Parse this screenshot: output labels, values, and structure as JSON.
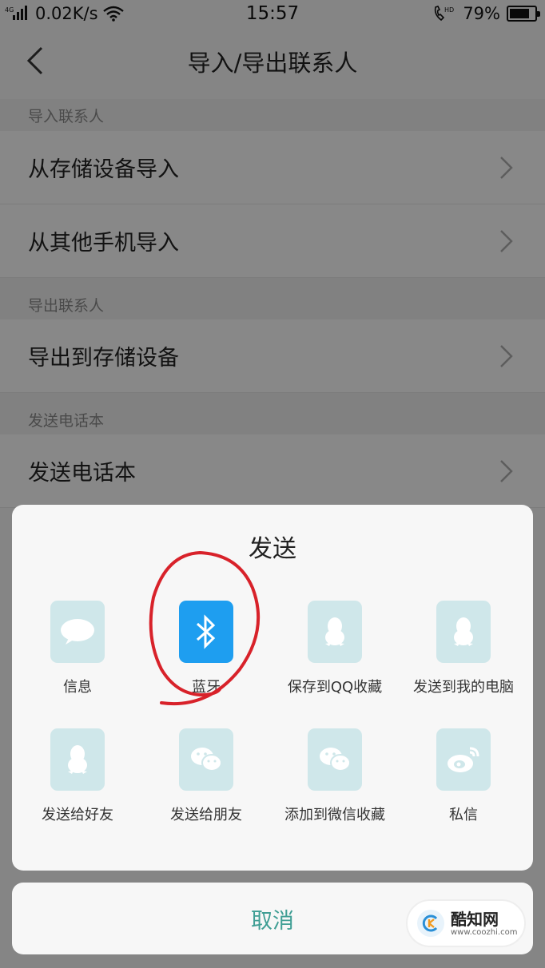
{
  "status_bar": {
    "network": "4G",
    "speed": "0.02K/s",
    "time": "15:57",
    "call_label": "HD",
    "battery": "79%",
    "battery_level": 0.79
  },
  "navbar": {
    "back_icon": "chevron-left-icon",
    "title": "导入/导出联系人"
  },
  "sections": [
    {
      "header": "导入联系人",
      "items": [
        "从存储设备导入",
        "从其他手机导入"
      ]
    },
    {
      "header": "导出联系人",
      "items": [
        "导出到存储设备"
      ]
    },
    {
      "header": "发送电话本",
      "items": [
        "发送电话本"
      ]
    }
  ],
  "share_sheet": {
    "title": "发送",
    "items": [
      {
        "label": "信息",
        "icon": "message-bubble-icon"
      },
      {
        "label": "蓝牙",
        "icon": "bluetooth-icon"
      },
      {
        "label": "保存到QQ收藏",
        "icon": "qq-icon"
      },
      {
        "label": "发送到我的电脑",
        "icon": "qq-icon"
      },
      {
        "label": "发送给好友",
        "icon": "qq-icon"
      },
      {
        "label": "发送给朋友",
        "icon": "wechat-icon"
      },
      {
        "label": "添加到微信收藏",
        "icon": "wechat-icon"
      },
      {
        "label": "私信",
        "icon": "weibo-icon"
      }
    ],
    "cancel_label": "取消"
  },
  "watermark": {
    "name": "酷知网",
    "url": "www.coozhi.com"
  },
  "colors": {
    "accent": "#3f9e94",
    "bluetooth": "#1e9ef0",
    "icon_bg": "#cfe7ea",
    "annotation": "#d8222a"
  }
}
